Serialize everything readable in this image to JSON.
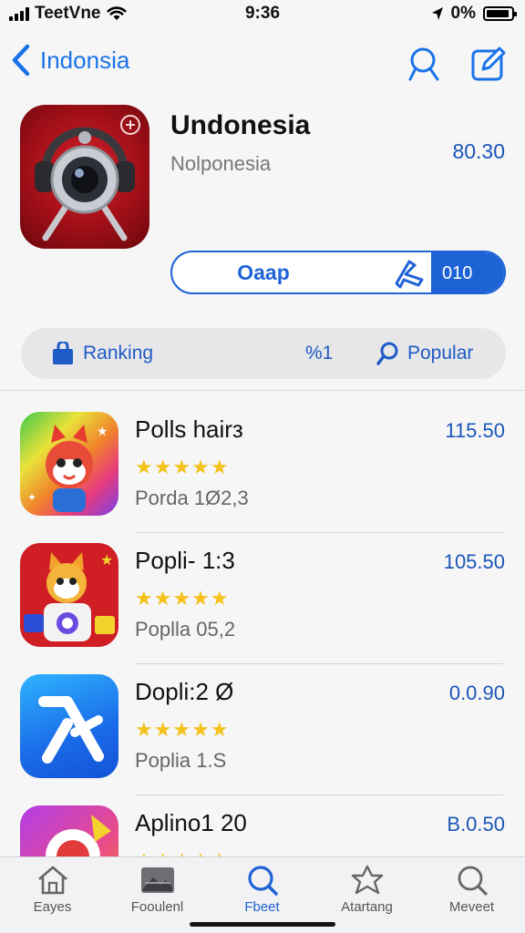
{
  "status_bar": {
    "carrier": "TeetVne",
    "time": "9:36",
    "battery": "0%"
  },
  "nav": {
    "back_label": "Indonsia",
    "icons": [
      "back-chevron-icon",
      "search-icon",
      "compose-icon"
    ]
  },
  "hero": {
    "title": "Undonesia",
    "subtitle": "Nolponesia",
    "price": "80.30",
    "get_label": "Oaap",
    "side_label": "010",
    "icon": "camera-headphones-icon"
  },
  "segments": {
    "ranking": "Ranking",
    "middle": "%1",
    "popular": "Popular"
  },
  "apps": [
    {
      "name": "Polls hairз",
      "stars": "★★★★★",
      "meta": "Porda 1Ø2,3",
      "price": "115.50",
      "icon": "rainbow-fox-app-icon"
    },
    {
      "name": "Popli- 1:3",
      "stars": "★★★★★",
      "meta": "Poplla 05,2",
      "price": "105.50",
      "icon": "fox-astronaut-app-icon"
    },
    {
      "name": "Dopli:2 Ø",
      "stars": "★★★★★",
      "meta": "Poplia 1.Ѕ",
      "price": "0.0.90",
      "icon": "app-store-a-icon"
    },
    {
      "name": "Aplino1 20",
      "stars": "★★★★★",
      "meta": "",
      "price": "B.0.50",
      "icon": "purple-app-icon"
    }
  ],
  "tabs": [
    {
      "label": "Eayes",
      "icon": "home-icon"
    },
    {
      "label": "Fooulenl",
      "icon": "image-icon"
    },
    {
      "label": "Fbeet",
      "icon": "search-icon"
    },
    {
      "label": "Atartang",
      "icon": "star-outline-icon"
    },
    {
      "label": "Meveet",
      "icon": "search-icon"
    }
  ],
  "colors": {
    "accent": "#1e63d6",
    "price": "#1a56b8",
    "star": "#f4c21b",
    "background": "#f6f6f7"
  }
}
